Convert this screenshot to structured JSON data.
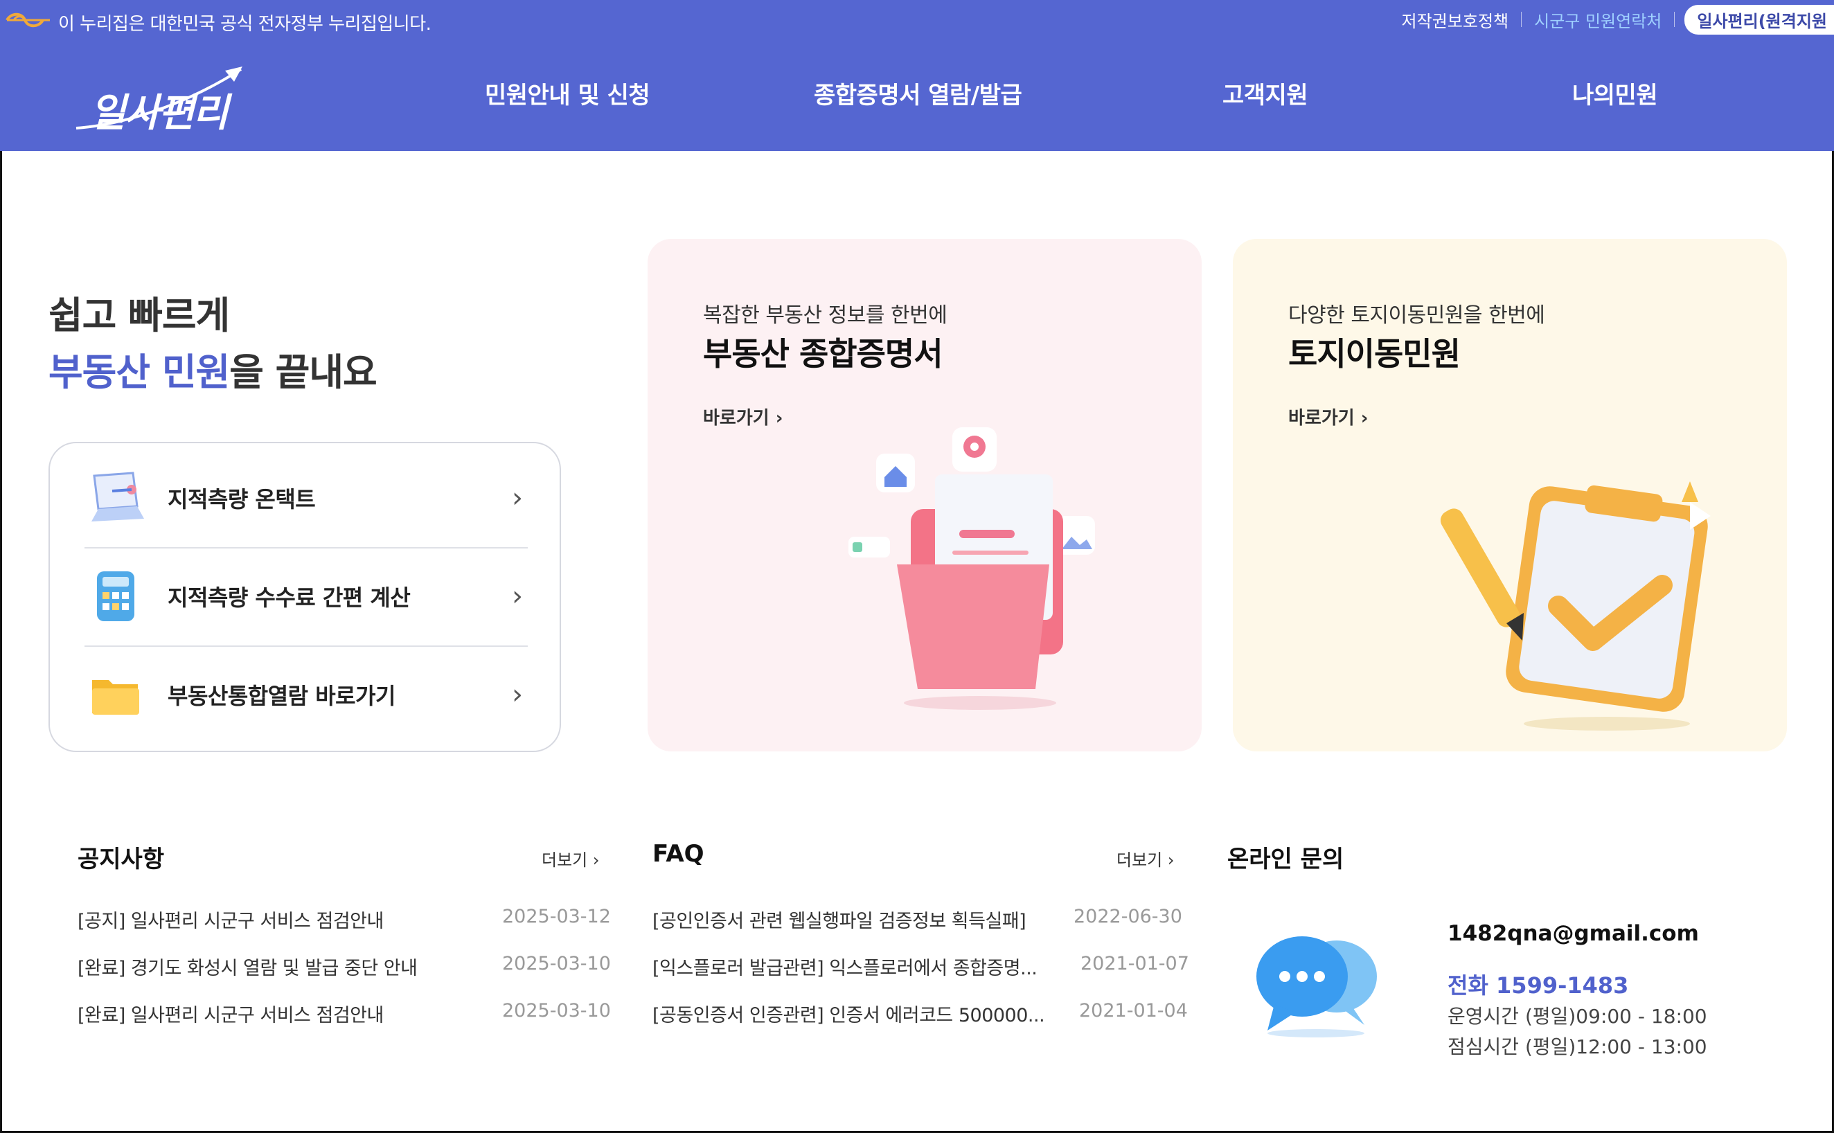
{
  "gov_bar": {
    "notice": "이 누리집은 대한민국 공식 전자정부 누리집입니다.",
    "links": [
      "저작권보호정책",
      "시군구 민원연락처"
    ],
    "pill": "일사편리(원격지원"
  },
  "header": {
    "logo": "일사편리",
    "nav": [
      "민원안내 및 신청",
      "종합증명서 열람/발급",
      "고객지원",
      "나의민원"
    ]
  },
  "hero": {
    "line1": "쉽고 빠르게",
    "line2_accent": "부동산 민원",
    "line2_rest": "을 끝내요"
  },
  "quick_links": [
    {
      "label": "지적측량 온택트",
      "icon": "laptop-icon"
    },
    {
      "label": "지적측량 수수료 간편 계산",
      "icon": "calculator-icon"
    },
    {
      "label": "부동산통합열람 바로가기",
      "icon": "folder-icon"
    }
  ],
  "cards": [
    {
      "sub": "복잡한 부동산 정보를 한번에",
      "title": "부동산 종합증명서",
      "link": "바로가기"
    },
    {
      "sub": "다양한 토지이동민원을 한번에",
      "title": "토지이동민원",
      "link": "바로가기"
    }
  ],
  "notices": {
    "title": "공지사항",
    "more": "더보기",
    "items": [
      {
        "text": "[공지] 일사편리 시군구 서비스 점검안내",
        "date": "2025-03-12"
      },
      {
        "text": "[완료] 경기도 화성시 열람 및 발급 중단 안내",
        "date": "2025-03-10"
      },
      {
        "text": "[완료] 일사편리 시군구 서비스 점검안내",
        "date": "2025-03-10"
      }
    ]
  },
  "faq": {
    "title": "FAQ",
    "more": "더보기",
    "items": [
      {
        "text": "[공인인증서 관련 웹실행파일 검증정보 획득실패]",
        "date": "2022-06-30"
      },
      {
        "text": "[익스플로러 발급관련] 익스플로러에서 종합증명...",
        "date": "2021-01-07"
      },
      {
        "text": "[공동인증서 인증관련] 인증서 에러코드 500000...",
        "date": "2021-01-04"
      }
    ]
  },
  "online": {
    "title": "온라인 문의",
    "email": "1482qna@gmail.com",
    "phone_label": "전화",
    "phone": "1599-1483",
    "hours": "운영시간 (평일)09:00 - 18:00",
    "lunch": "점심시간 (평일)12:00 - 13:00"
  },
  "colors": {
    "brand": "#5566d1",
    "accent": "#5061cc",
    "pink_card": "#fdf1f3",
    "yellow_card": "#fef8e8"
  }
}
